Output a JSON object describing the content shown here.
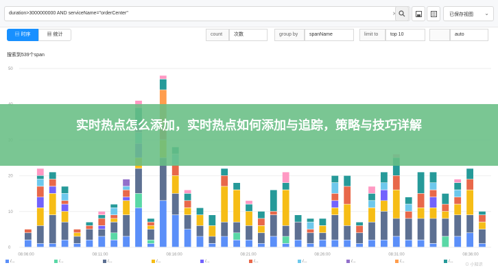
{
  "query": {
    "value": "duration>3000000000 AND serviceName=\"orderCenter\"",
    "clear_icon": "close-icon",
    "search_icon": "search-icon",
    "save_icon": "save-icon",
    "menu_icon": "list-icon"
  },
  "saved_queries": {
    "label": "已保存视图",
    "icon": "chevron-down-icon"
  },
  "view_tabs": [
    {
      "label": "时序",
      "icon": "table-icon",
      "active": true
    },
    {
      "label": "统计",
      "icon": "grid-icon",
      "active": false
    }
  ],
  "filters": [
    {
      "label": "count",
      "value": "次数"
    },
    {
      "label": "group by",
      "value": "spanName"
    },
    {
      "label": "limit to",
      "value": "top 10"
    },
    {
      "label": "",
      "value": "auto"
    }
  ],
  "chart_title": "搜索到539个span",
  "chart_data": {
    "type": "bar",
    "stacked": true,
    "ylim": [
      0,
      50
    ],
    "yticks": [
      0,
      10,
      20,
      30,
      40,
      50
    ],
    "xticks": [
      "08:06:00",
      "08:11:00",
      "08:16:00",
      "08:21:00",
      "08:26:00",
      "08:31:00",
      "08:36:00"
    ],
    "colors": [
      "#5b8ff9",
      "#5ad8a6",
      "#5d7092",
      "#f6bd16",
      "#7262fd",
      "#e8684a",
      "#6dc8ec",
      "#9270ca",
      "#ff9d4d",
      "#269a99",
      "#ff99c3"
    ],
    "stacks": [
      [
        2,
        0,
        2,
        0,
        0,
        1,
        0,
        0,
        0,
        0,
        0
      ],
      [
        1,
        0,
        5,
        5,
        3,
        3,
        2,
        0,
        0,
        1,
        2
      ],
      [
        1,
        0,
        8,
        6,
        2,
        2,
        0,
        0,
        0,
        2,
        0
      ],
      [
        2,
        0,
        5,
        3,
        2,
        1,
        2,
        0,
        0,
        2,
        0
      ],
      [
        1,
        0,
        2,
        1,
        0,
        1,
        0,
        0,
        0,
        0,
        0
      ],
      [
        2,
        0,
        3,
        0,
        0,
        1,
        0,
        0,
        0,
        1,
        0
      ],
      [
        3,
        0,
        2,
        0,
        1,
        2,
        0,
        0,
        0,
        1,
        1
      ],
      [
        2,
        2,
        3,
        1,
        0,
        1,
        2,
        0,
        0,
        1,
        0
      ],
      [
        3,
        0,
        6,
        4,
        1,
        2,
        1,
        2,
        0,
        0,
        0
      ],
      [
        11,
        4,
        7,
        3,
        4,
        0,
        3,
        2,
        0,
        5,
        2
      ],
      [
        1,
        1,
        3,
        1,
        0,
        1,
        0,
        0,
        0,
        1,
        0
      ],
      [
        13,
        0,
        12,
        5,
        0,
        4,
        0,
        0,
        10,
        3,
        1
      ],
      [
        9,
        0,
        6,
        5,
        0,
        3,
        3,
        0,
        0,
        2,
        0
      ],
      [
        5,
        0,
        4,
        2,
        0,
        2,
        0,
        0,
        0,
        2,
        1
      ],
      [
        3,
        0,
        3,
        3,
        0,
        0,
        0,
        0,
        0,
        2,
        0
      ],
      [
        1,
        0,
        2,
        3,
        0,
        0,
        0,
        0,
        0,
        3,
        0
      ],
      [
        3,
        0,
        4,
        10,
        0,
        3,
        0,
        0,
        0,
        2,
        0
      ],
      [
        2,
        2,
        3,
        9,
        0,
        0,
        0,
        0,
        0,
        2,
        0
      ],
      [
        2,
        0,
        4,
        4,
        0,
        0,
        0,
        0,
        0,
        2,
        1
      ],
      [
        1,
        0,
        3,
        2,
        0,
        2,
        0,
        0,
        0,
        2,
        0
      ],
      [
        3,
        0,
        6,
        0,
        0,
        1,
        0,
        0,
        0,
        6,
        0
      ],
      [
        1,
        2,
        3,
        10,
        0,
        0,
        0,
        0,
        0,
        2,
        3
      ],
      [
        2,
        0,
        5,
        0,
        0,
        0,
        0,
        0,
        0,
        2,
        0
      ],
      [
        1,
        0,
        3,
        0,
        0,
        1,
        2,
        0,
        0,
        1,
        0
      ],
      [
        2,
        0,
        2,
        2,
        0,
        0,
        0,
        0,
        0,
        2,
        0
      ],
      [
        2,
        0,
        7,
        2,
        2,
        2,
        3,
        0,
        0,
        2,
        0
      ],
      [
        2,
        0,
        4,
        6,
        0,
        5,
        0,
        0,
        0,
        3,
        0
      ],
      [
        1,
        0,
        3,
        0,
        0,
        2,
        0,
        0,
        0,
        1,
        0
      ],
      [
        2,
        0,
        5,
        4,
        0,
        0,
        2,
        0,
        0,
        2,
        2
      ],
      [
        2,
        0,
        8,
        3,
        3,
        0,
        2,
        0,
        0,
        3,
        0
      ],
      [
        3,
        0,
        5,
        8,
        0,
        4,
        0,
        0,
        0,
        5,
        1
      ],
      [
        2,
        0,
        6,
        0,
        0,
        2,
        2,
        0,
        0,
        2,
        0
      ],
      [
        2,
        0,
        6,
        3,
        0,
        4,
        0,
        0,
        0,
        6,
        0
      ],
      [
        1,
        0,
        7,
        3,
        3,
        2,
        2,
        0,
        0,
        3,
        0
      ],
      [
        0,
        3,
        5,
        2,
        0,
        2,
        0,
        0,
        0,
        3,
        0
      ],
      [
        3,
        0,
        6,
        3,
        0,
        2,
        2,
        0,
        0,
        2,
        1
      ],
      [
        4,
        0,
        5,
        7,
        0,
        3,
        0,
        0,
        0,
        3,
        0
      ],
      [
        1,
        0,
        4,
        2,
        0,
        2,
        0,
        0,
        0,
        1,
        0
      ]
    ]
  },
  "legend": [
    {
      "label": "/...",
      "color": "#5b8ff9"
    },
    {
      "label": "/...",
      "color": "#5ad8a6"
    },
    {
      "label": "/...",
      "color": "#5d7092"
    },
    {
      "label": "/...",
      "color": "#f6bd16"
    },
    {
      "label": "/...",
      "color": "#7262fd"
    },
    {
      "label": "/...",
      "color": "#e8684a"
    },
    {
      "label": "/...",
      "color": "#6dc8ec"
    },
    {
      "label": "/...",
      "color": "#9270ca"
    },
    {
      "label": "/...",
      "color": "#ff9d4d"
    },
    {
      "label": "/...",
      "color": "#269a99"
    }
  ],
  "banner": {
    "title": "实时热点怎么添加，实时热点如何添加与追踪，策略与技巧详解"
  },
  "watermark": "⊙ 小知识"
}
